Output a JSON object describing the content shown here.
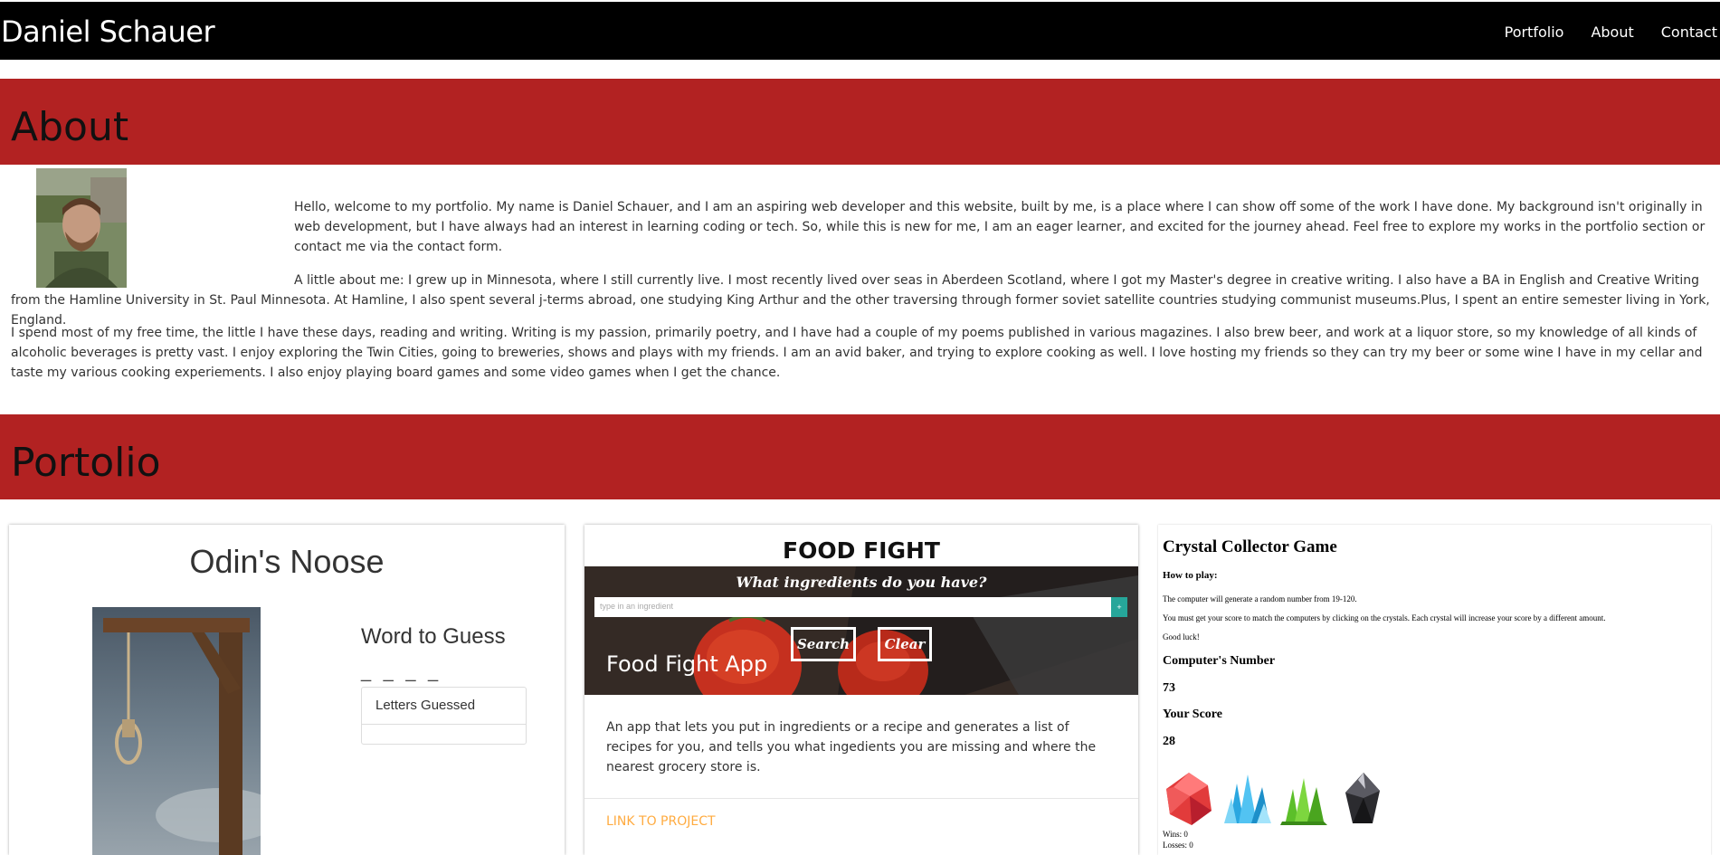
{
  "nav": {
    "brand": "Daniel Schauer",
    "links": [
      "Portfolio",
      "About",
      "Contact"
    ]
  },
  "about": {
    "heading": "About",
    "paragraphs": [
      "Hello, welcome to my portfolio. My name is Daniel Schauer, and I am an aspiring web developer and this website, built by me, is a place where I can show off some of the work I have done. My background isn't originally in web development, but I have always had an interest in learning coding or tech. So, while this is new for me, I am an eager learner, and excited for the journey ahead. Feel free to explore my works in the portfolio section or contact me via the contact form.",
      "A little about me: I grew up in Minnesota, where I still currently live. I most recently lived over seas in Aberdeen Scotland, where I got my Master's degree in creative writing. I also have a BA in English and Creative Writing from the Hamline University in St. Paul Minnesota. At Hamline, I also spent several j-terms abroad, one studying King Arthur and the other traversing through former soviet satellite countries studying communist museums.Plus, I spent an entire semester living in York, England.",
      "I spend most of my free time, the little I have these days, reading and writing. Writing is my passion, primarily poetry, and I have had a couple of my poems published in various magazines. I also brew beer, and work at a liquor store, so my knowledge of all kinds of alcoholic beverages is pretty vast. I enjoy exploring the Twin Cities, going to breweries, shows and plays with my friends. I am an avid baker, and trying to explore cooking as well. I love hosting my friends so they can try my beer or some wine I have in my cellar and taste my various cooking experiements. I also enjoy playing board games and some video games when I get the chance."
    ]
  },
  "portfolio": {
    "heading": "Portolio",
    "odin": {
      "title": "Odin's Noose",
      "word_heading": "Word to Guess",
      "blanks": "_ _ _ _",
      "letters_guessed_label": "Letters Guessed"
    },
    "food": {
      "logo": "FOOD FIGHT",
      "question": "What ingredients do you have?",
      "input_placeholder": "type in an ingredient",
      "input_button": "+",
      "search_label": "Search",
      "clear_label": "Clear",
      "card_title": "Food Fight App",
      "description": "An app that lets you put in ingredients or a recipe and generates a list of recipes for you, and tells you what ingedients you are missing and where the nearest grocery store is.",
      "link_label": "LINK TO PROJECT",
      "accent_link_color": "#ffab40",
      "accent_button_color": "#26a69a"
    },
    "crystal": {
      "title": "Crystal Collector Game",
      "how_to": "How to play:",
      "lines": [
        "The computer will generate a random number from 19-120.",
        "You must get your score to match the computers by clicking on the crystals. Each crystal will increase your score by a different amount.",
        "Good luck!"
      ],
      "computer_label": "Computer's Number",
      "computer_value": "73",
      "score_label": "Your Score",
      "score_value": "28",
      "crystals": [
        "red-crystal-icon",
        "blue-crystal-icon",
        "green-crystal-icon",
        "black-crystal-icon"
      ],
      "wins": "Wins: 0",
      "losses": "Losses: 0"
    }
  },
  "colors": {
    "banner": "#b22222",
    "navbar": "#000000"
  }
}
